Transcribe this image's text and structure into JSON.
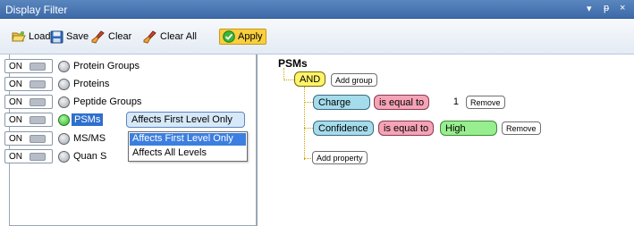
{
  "window": {
    "title": "Display Filter",
    "controls": [
      "▾",
      "ᵽ",
      "×"
    ]
  },
  "toolbar": {
    "load_label": "Load",
    "save_label": "Save",
    "clear_label": "Clear",
    "clear_all_label": "Clear All",
    "apply_label": "Apply"
  },
  "levels": [
    {
      "toggle": "ON",
      "label": "Protein Groups",
      "active": false
    },
    {
      "toggle": "ON",
      "label": "Proteins",
      "active": false
    },
    {
      "toggle": "ON",
      "label": "Peptide Groups",
      "active": false
    },
    {
      "toggle": "ON",
      "label": "PSMs",
      "active": true
    },
    {
      "toggle": "ON",
      "label": "MS/MS",
      "active": false
    },
    {
      "toggle": "ON",
      "label": "Quan S",
      "active": false
    }
  ],
  "scope_combo": {
    "selected": "Affects First Level Only",
    "options": [
      "Affects First Level Only",
      "Affects All Levels"
    ]
  },
  "filter_tree": {
    "root": "PSMs",
    "group_operator": "AND",
    "add_group_label": "Add group",
    "conditions": [
      {
        "property": "Charge",
        "operator": "is equal to",
        "value": "1",
        "remove_label": "Remove"
      },
      {
        "property": "Confidence",
        "operator": "is equal to",
        "value": "High",
        "remove_label": "Remove"
      }
    ],
    "add_property_label": "Add property"
  },
  "colors": {
    "title_bar": "#4a77b4",
    "apply_highlight": "#f9cf3f",
    "and_pill": "#fff36b",
    "property_pill": "#a5dcec",
    "operator_pill": "#f5a3b6",
    "value_pill": "#97ee8e",
    "selection": "#2f6fcd"
  }
}
